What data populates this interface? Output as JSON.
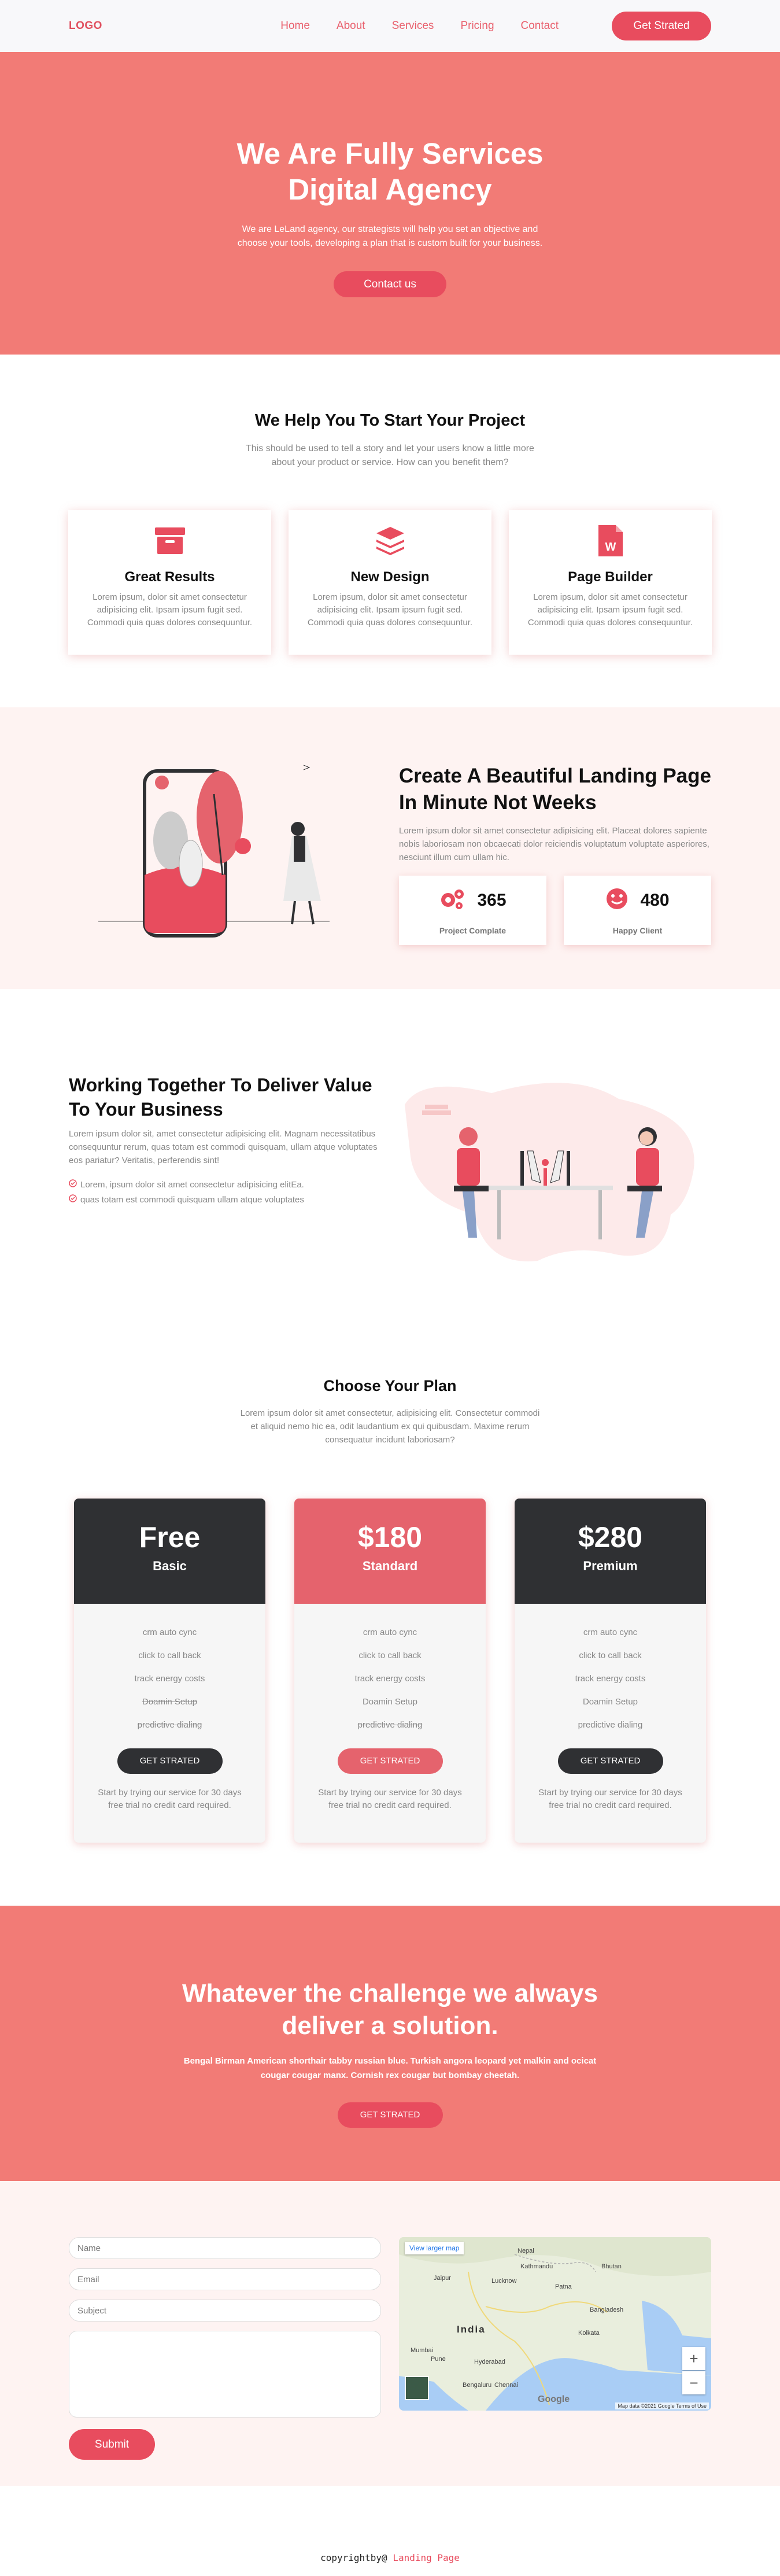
{
  "nav": {
    "logo": "LOGO",
    "links": [
      "Home",
      "About",
      "Services",
      "Pricing",
      "Contact"
    ],
    "cta": "Get Strated"
  },
  "hero": {
    "title": "We Are Fully Services Digital Agency",
    "text": "We are LeLand agency, our strategists will help you set an objective and choose your tools, developing a plan that is custom built for your business.",
    "button": "Contact us"
  },
  "help": {
    "title": "We Help You To Start Your Project",
    "subtitle": "This should be used to tell a story and let your users know a little more about your product or service. How can you benefit them?",
    "cards": [
      {
        "title": "Great Results",
        "text": "Lorem ipsum, dolor sit amet consectetur adipisicing elit. Ipsam ipsum fugit sed. Commodi quia quas dolores consequuntur."
      },
      {
        "title": "New Design",
        "text": "Lorem ipsum, dolor sit amet consectetur adipisicing elit. Ipsam ipsum fugit sed. Commodi quia quas dolores consequuntur."
      },
      {
        "title": "Page Builder",
        "text": "Lorem ipsum, dolor sit amet consectetur adipisicing elit. Ipsam ipsum fugit sed. Commodi quia quas dolores consequuntur."
      }
    ]
  },
  "landing": {
    "title": "Create A Beautiful Landing Page In Minute Not Weeks",
    "text": "Lorem ipsum dolor sit amet consectetur adipisicing elit. Placeat dolores sapiente nobis laboriosam non obcaecati dolor reiciendis voluptatum voluptate asperiores, nesciunt illum cum ullam hic.",
    "stats": [
      {
        "value": "365",
        "label": "Project Complate"
      },
      {
        "value": "480",
        "label": "Happy Client"
      }
    ]
  },
  "work": {
    "title": "Working Together To Deliver Value To Your Business",
    "text": "Lorem ipsum dolor sit, amet consectetur adipisicing elit. Magnam necessitatibus consequuntur rerum, quas totam est commodi quisquam, ullam atque voluptates eos pariatur? Veritatis, perferendis sint!",
    "items": [
      "Lorem, ipsum dolor sit amet consectetur adipisicing elitEa.",
      "quas totam est commodi quisquam ullam atque voluptates"
    ]
  },
  "plans": {
    "title": "Choose Your Plan",
    "subtitle": "Lorem ipsum dolor sit amet consectetur, adipisicing elit. Consectetur commodi et aliquid nemo hic ea, odit laudantium ex qui quibusdam. Maxime rerum consequatur incidunt laboriosam?",
    "cards": [
      {
        "price": "Free",
        "name": "Basic",
        "features": [
          "crm auto cync",
          "click to call back",
          "track energy costs",
          "Doamin Setup",
          "predictive dialing"
        ],
        "button": "GET STRATED",
        "note": "Start by trying our service for 30 days free trial no credit card required."
      },
      {
        "price": "$180",
        "name": "Standard",
        "features": [
          "crm auto cync",
          "click to call back",
          "track energy costs",
          "Doamin Setup",
          "predictive dialing"
        ],
        "button": "GET STRATED",
        "note": "Start by trying our service for 30 days free trial no credit card required."
      },
      {
        "price": "$280",
        "name": "Premium",
        "features": [
          "crm auto cync",
          "click to call back",
          "track energy costs",
          "Doamin Setup",
          "predictive dialing"
        ],
        "button": "GET STRATED",
        "note": "Start by trying our service for 30 days free trial no credit card required."
      }
    ]
  },
  "challenge": {
    "title": "Whatever the challenge we always deliver a solution.",
    "text": "Bengal Birman American shorthair tabby russian blue. Turkish angora leopard yet malkin and ocicat cougar cougar manx. Cornish rex cougar but bombay cheetah.",
    "button": "GET STRATED"
  },
  "contact": {
    "name_placeholder": "Name",
    "email_placeholder": "Email",
    "subject_placeholder": "Subject",
    "submit": "Submit",
    "map": {
      "view_larger": "View larger map",
      "labels": {
        "country": "India",
        "cities": [
          "Nepal",
          "Kathmandu",
          "Bhutan",
          "Jaipur",
          "Lucknow",
          "Patna",
          "Bangladesh",
          "Kolkata",
          "Hyderabad",
          "Chennai",
          "Mumbai",
          "Pune",
          "Bengaluru"
        ]
      },
      "attribution": "Map data ©2021 Google   Terms of Use",
      "logo": "Google"
    }
  },
  "footer": {
    "prefix": "copyrightby@",
    "brand": "Landing Page"
  },
  "colors": {
    "brand": "#e84c5e",
    "hero_bg": "#f27b76",
    "light_bg": "#fef3f2",
    "dark": "#2f3033"
  }
}
